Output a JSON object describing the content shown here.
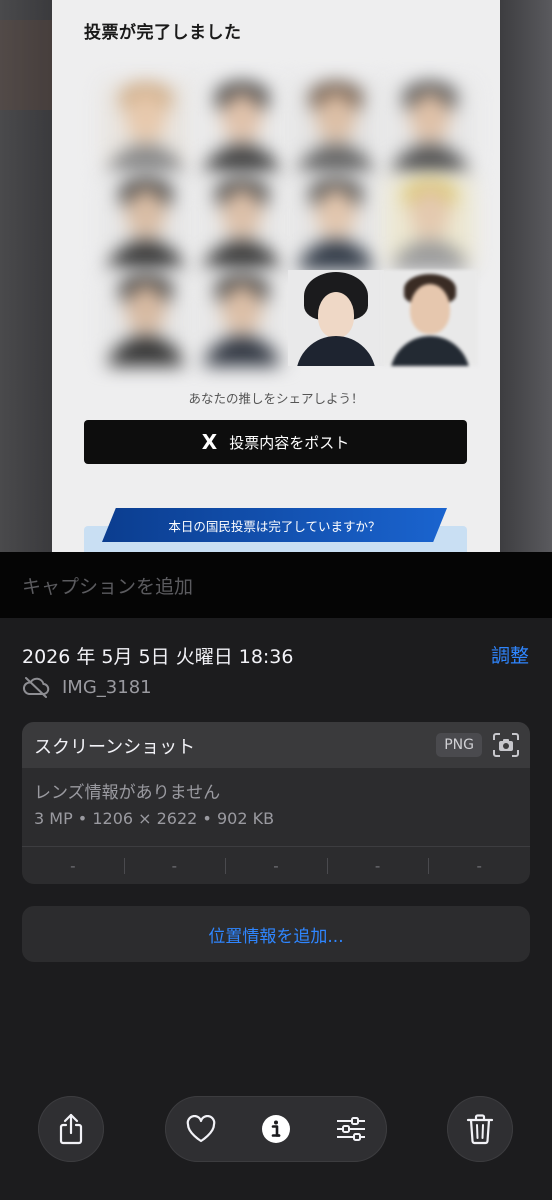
{
  "screenshot_preview": {
    "title": "投票が完了しました",
    "share_prompt": "あなたの推しをシェアしよう！",
    "post_button_icon": "X",
    "post_button_label": "投票内容をポスト",
    "banner_text": "本日の国民投票は完了していますか？"
  },
  "caption": {
    "placeholder": "キャプションを追加"
  },
  "info": {
    "date": "2026 年 5月 5日 火曜日 18:36",
    "adjust_label": "調整",
    "filename": "IMG_3181",
    "cloud_icon": "cloud-slash-icon"
  },
  "details_card": {
    "title": "スクリーンショット",
    "format_badge": "PNG",
    "camera_icon": "camera-viewfinder-icon",
    "lens_text": "レンズ情報がありません",
    "spec_text": "3 MP • 1206 × 2622 • 902 KB",
    "exif_cells": [
      "-",
      "-",
      "-",
      "-",
      "-"
    ]
  },
  "location_button": "位置情報を追加...",
  "toolbar": {
    "share_icon": "share-icon",
    "favorite_icon": "heart-icon",
    "info_icon": "info-icon",
    "adjust_icon": "sliders-icon",
    "delete_icon": "trash-icon"
  },
  "colors": {
    "accent": "#2f86ff",
    "background": "#1c1c1e",
    "card": "#2c2c2e"
  }
}
